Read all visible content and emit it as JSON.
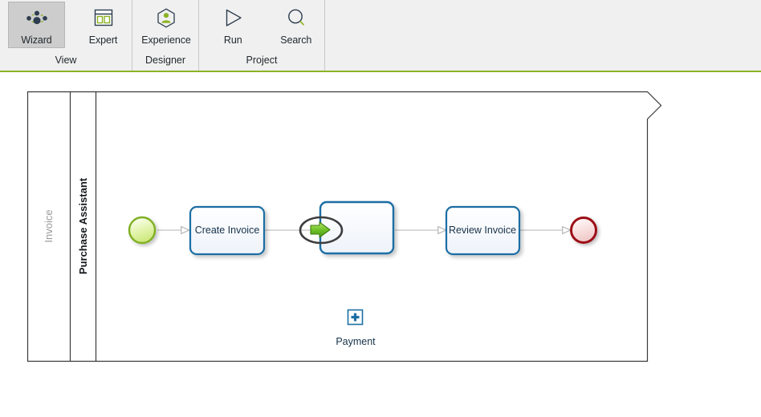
{
  "ribbon": {
    "groups": [
      {
        "name": "View",
        "label": "View",
        "buttons": [
          {
            "id": "wizard",
            "label": "Wizard",
            "icon": "wizard-icon",
            "selected": true
          },
          {
            "id": "expert",
            "label": "Expert",
            "icon": "expert-window-icon",
            "selected": false
          }
        ]
      },
      {
        "name": "Designer",
        "label": "Designer",
        "buttons": [
          {
            "id": "experience",
            "label": "Experience",
            "icon": "experience-person-hexagon-icon",
            "selected": false
          }
        ]
      },
      {
        "name": "Project",
        "label": "Project",
        "buttons": [
          {
            "id": "run",
            "label": "Run",
            "icon": "run-play-triangle-icon",
            "selected": false
          },
          {
            "id": "search",
            "label": "Search",
            "icon": "search-magnifier-icon",
            "selected": false
          }
        ]
      }
    ]
  },
  "diagram": {
    "type": "bpmn-process",
    "pool": {
      "label": "Invoice"
    },
    "lane": {
      "label": "Purchase Assistant"
    },
    "nodes": [
      {
        "id": "start",
        "type": "start-event",
        "label": ""
      },
      {
        "id": "create-invoice",
        "type": "task",
        "label": "Create Invoice"
      },
      {
        "id": "payment",
        "type": "collapsed-subprocess",
        "label": "Payment",
        "markers": [
          "plus",
          "green-arrow-ellipse"
        ]
      },
      {
        "id": "review-invoice",
        "type": "task",
        "label": "Review Invoice"
      },
      {
        "id": "end",
        "type": "end-event",
        "label": ""
      }
    ],
    "flows": [
      {
        "from": "start",
        "to": "create-invoice"
      },
      {
        "from": "create-invoice",
        "to": "payment"
      },
      {
        "from": "payment",
        "to": "review-invoice"
      },
      {
        "from": "review-invoice",
        "to": "end"
      }
    ]
  },
  "colors": {
    "ribbon_bg": "#f0f0f0",
    "accent_green": "#8cb224",
    "icon_dark": "#2d3c4e",
    "task_border": "#1c6ea4",
    "start_event_green": "#7fb020",
    "end_event_red": "#9c1018",
    "flow_gray": "#c3c3c3"
  }
}
